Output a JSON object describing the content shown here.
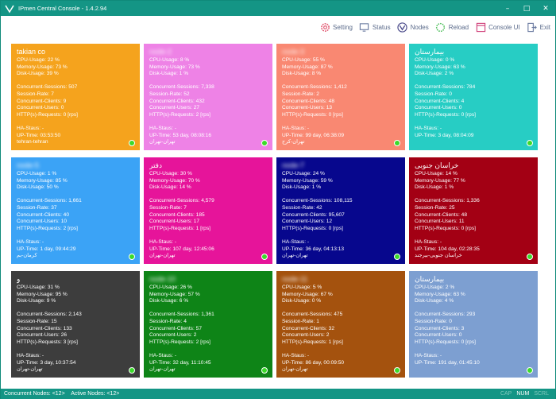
{
  "window": {
    "title": "IPmen Central Console - 1.4.2.94"
  },
  "toolbar": {
    "items": [
      {
        "label": "Setting",
        "icon": "gear-icon",
        "color": "#e0506a"
      },
      {
        "label": "Status",
        "icon": "status-icon",
        "color": "#6a7aa0"
      },
      {
        "label": "Nodes",
        "icon": "nodes-icon",
        "color": "#4a4a8a"
      },
      {
        "label": "Reload",
        "icon": "reload-icon",
        "color": "#3bb84a"
      },
      {
        "label": "Console UI",
        "icon": "console-icon",
        "color": "#d0407a"
      },
      {
        "label": "Exit",
        "icon": "exit-icon",
        "color": "#6a7aa0"
      }
    ]
  },
  "labels": {
    "cpu": "CPU-Usage:",
    "mem": "Memory-Usage:",
    "disk": "Disk-Usage:",
    "sessions": "Concurrent-Sessions:",
    "rate": "Session-Rate:",
    "clients": "Concurrent-Clients:",
    "users": "Concurrent-Users:",
    "http": "HTTP(s)-Requests:",
    "ha": "HA-Staus:",
    "uptime": "UP-Time:"
  },
  "nodes": [
    {
      "name": "takian co",
      "blurred": false,
      "color": "#f5a31d",
      "cpu": "22 %",
      "mem": "73 %",
      "disk": "39 %",
      "sessions": "507",
      "rate": "7",
      "clients": "9",
      "users": "0",
      "http": "0 [rps]",
      "ha": "-",
      "uptime": "03:53:50",
      "location": "tehran-tehran"
    },
    {
      "name": "node-2",
      "blurred": true,
      "color": "#ee82e6",
      "cpu": "8 %",
      "mem": "73 %",
      "disk": "1 %",
      "sessions": "7,338",
      "rate": "52",
      "clients": "432",
      "users": "27",
      "http": "2 [rps]",
      "ha": "-",
      "uptime": "53 day, 08:08:16",
      "location": "تهران-تهران"
    },
    {
      "name": "node-3",
      "blurred": true,
      "color": "#f98872",
      "cpu": "55 %",
      "mem": "87 %",
      "disk": "8 %",
      "sessions": "1,412",
      "rate": "2",
      "clients": "48",
      "users": "13",
      "http": "0 [rps]",
      "ha": "-",
      "uptime": "99 day, 06:38:09",
      "location": "تهران-کرج"
    },
    {
      "name": "بیمارستان",
      "blurred": false,
      "color": "#27cdc4",
      "cpu": "0 %",
      "mem": "63 %",
      "disk": "2 %",
      "sessions": "784",
      "rate": "0",
      "clients": "4",
      "users": "0",
      "http": "0 [rps]",
      "ha": "-",
      "uptime": "3 day, 08:04:09",
      "location": ""
    },
    {
      "name": "node-5",
      "blurred": true,
      "color": "#3ba3f6",
      "cpu": "1 %",
      "mem": "85 %",
      "disk": "50 %",
      "sessions": "1,661",
      "rate": "37",
      "clients": "40",
      "users": "10",
      "http": "2 [rps]",
      "ha": "-",
      "uptime": "1 day, 09:44:29",
      "location": "کرمان-بم"
    },
    {
      "name": "دفتر",
      "blurred": false,
      "color": "#e6149a",
      "cpu": "30 %",
      "mem": "70 %",
      "disk": "14 %",
      "sessions": "4,579",
      "rate": "7",
      "clients": "185",
      "users": "17",
      "http": "1 [rps]",
      "ha": "-",
      "uptime": "107 day, 12:45:06",
      "location": "تهران-تهران"
    },
    {
      "name": "node-7",
      "blurred": true,
      "color": "#07078d",
      "cpu": "24 %",
      "mem": "59 %",
      "disk": "1 %",
      "sessions": "108,115",
      "rate": "42",
      "clients": "95,607",
      "users": "12",
      "http": "0 [rps]",
      "ha": "-",
      "uptime": "36 day, 04:13:13",
      "location": "تهران-تهران"
    },
    {
      "name": "خراسان جنوبی",
      "blurred": false,
      "color": "#a30014",
      "cpu": "14 %",
      "mem": "77 %",
      "disk": "1 %",
      "sessions": "1,336",
      "rate": "25",
      "clients": "48",
      "users": "11",
      "http": "0 [rps]",
      "ha": "-",
      "uptime": "104 day, 02:28:35",
      "location": "خراسان جنوبی-بیرجند"
    },
    {
      "name": "و",
      "blurred": false,
      "color": "#3d3d3d",
      "cpu": "31 %",
      "mem": "95 %",
      "disk": "9 %",
      "sessions": "2,143",
      "rate": "15",
      "clients": "133",
      "users": "26",
      "http": "3 [rps]",
      "ha": "-",
      "uptime": "3 day, 10:37:54",
      "location": "تهران-تهران"
    },
    {
      "name": "node-10",
      "blurred": true,
      "color": "#0e8417",
      "cpu": "26 %",
      "mem": "57 %",
      "disk": "6 %",
      "sessions": "1,361",
      "rate": "4",
      "clients": "57",
      "users": "2",
      "http": "2 [rps]",
      "ha": "-",
      "uptime": "32 day, 11:10:45",
      "location": "تهران-تهران"
    },
    {
      "name": "node-11",
      "blurred": true,
      "color": "#a4520e",
      "cpu": "5 %",
      "mem": "67 %",
      "disk": "0 %",
      "sessions": "475",
      "rate": "1",
      "clients": "32",
      "users": "2",
      "http": "1 [rps]",
      "ha": "-",
      "uptime": "86 day, 00:09:50",
      "location": "تهران-تهران"
    },
    {
      "name": "بیمارستان",
      "blurred": false,
      "color": "#7d9fd1",
      "cpu": "2 %",
      "mem": "63 %",
      "disk": "4 %",
      "sessions": "293",
      "rate": "0",
      "clients": "3",
      "users": "0",
      "http": "0 [rps]",
      "ha": "-",
      "uptime": "191 day, 01:45:10",
      "location": ""
    }
  ],
  "statusbar": {
    "concurrent_nodes": "Concurrent Nodes: <12>",
    "active_nodes": "Active Nodes: <12>",
    "cap": "CAP",
    "num": "NUM",
    "scrl": "SCRL"
  }
}
